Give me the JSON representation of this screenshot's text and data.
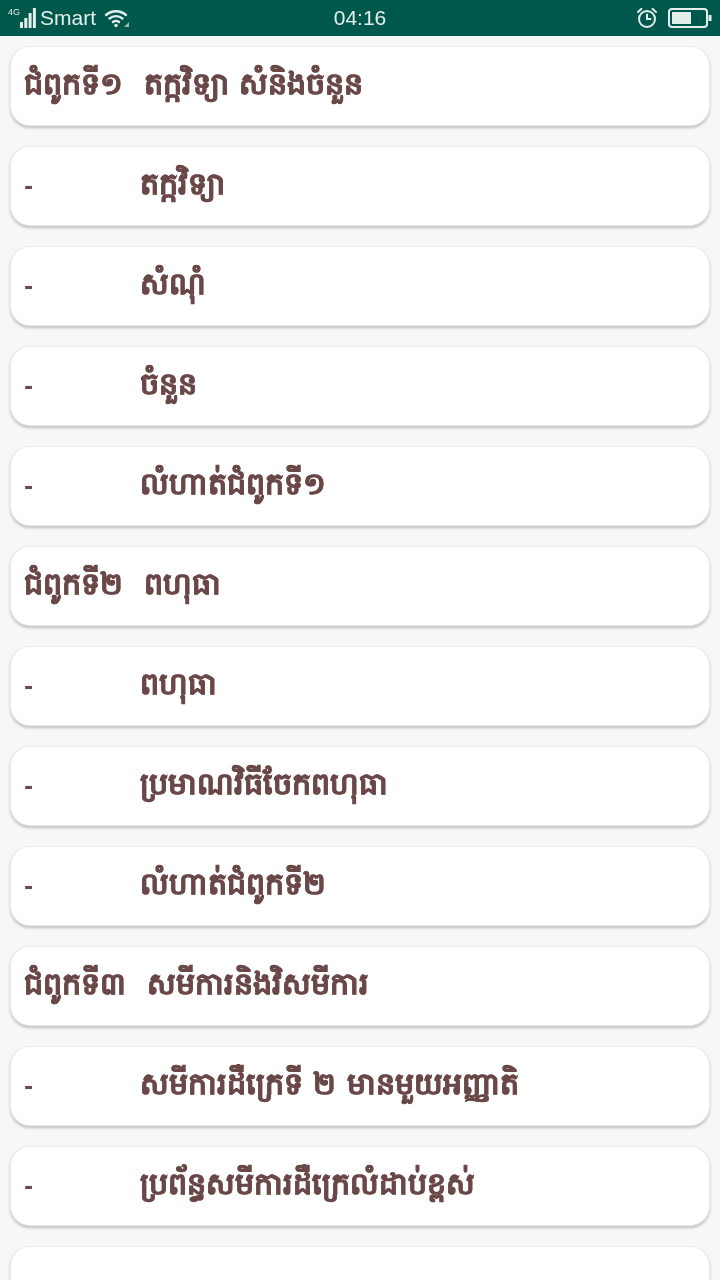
{
  "status_bar": {
    "network": "4G",
    "carrier": "Smart",
    "time": "04:16"
  },
  "lessons": [
    {
      "kind": "chapter",
      "title": "ជំពូកទី១  តក្កវិទ្យា សំនិងចំនួន"
    },
    {
      "kind": "topic",
      "bullet": "-",
      "title": "តក្កវិទ្យា"
    },
    {
      "kind": "topic",
      "bullet": "-",
      "title": "សំណុំ"
    },
    {
      "kind": "topic",
      "bullet": "-",
      "title": "ចំនួន"
    },
    {
      "kind": "topic",
      "bullet": "-",
      "title": "លំហាត់ជំពូកទី១"
    },
    {
      "kind": "chapter",
      "title": "ជំពូកទី២  ពហុធា"
    },
    {
      "kind": "topic",
      "bullet": "-",
      "title": "ពហុធា"
    },
    {
      "kind": "topic",
      "bullet": "-",
      "title": "ប្រមាណវិធីចែកពហុធា"
    },
    {
      "kind": "topic",
      "bullet": "-",
      "title": "លំហាត់ជំពូកទី២"
    },
    {
      "kind": "chapter",
      "title": "ជំពូកទី៣  សមីការនិងវិសមីការ"
    },
    {
      "kind": "topic",
      "bullet": "-",
      "title": "សមីការដឺក្រេទី ២ មានមួយអញ្ញាតិ"
    },
    {
      "kind": "topic",
      "bullet": "-",
      "title": "ប្រព័ន្ធសមីការដឺក្រេលំដាប់ខ្ពស់"
    },
    {
      "kind": "topic"
    }
  ]
}
